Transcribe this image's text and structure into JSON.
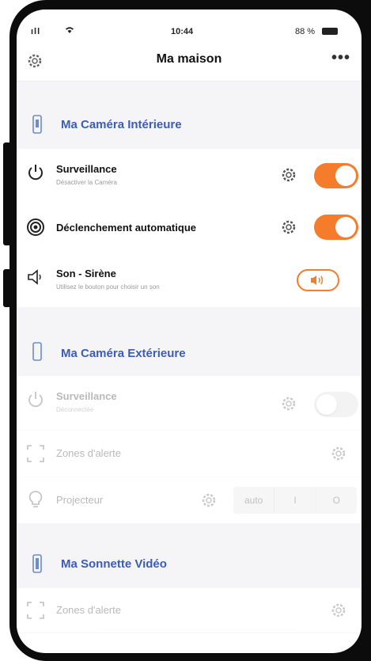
{
  "status": {
    "signal": "ıll",
    "time": "10:44",
    "battery": "88 %"
  },
  "header": {
    "title": "Ma maison",
    "more": "•••",
    "settings_icon": "gear-icon"
  },
  "sections": {
    "interior": {
      "label": "Ma Caméra Intérieure"
    },
    "exterior": {
      "label": "Ma Caméra Extérieure"
    },
    "doorbell": {
      "label": "Ma Sonnette Vidéo"
    }
  },
  "interior": {
    "surveillance": {
      "title": "Surveillance",
      "subtitle": "Désactiver la Caméra",
      "on": true
    },
    "auto": {
      "title": "Déclenchement automatique",
      "on": true
    },
    "siren": {
      "title": "Son - Sirène",
      "subtitle": "Utilisez le bouton pour choisir un son"
    }
  },
  "exterior": {
    "surveillance": {
      "title": "Surveillance",
      "subtitle": "Déconnectée",
      "on": false
    },
    "zones": {
      "title": "Zones d'alerte"
    },
    "projector": {
      "title": "Projecteur",
      "options": [
        "auto",
        "I",
        "O"
      ]
    }
  },
  "doorbell": {
    "zones": {
      "title": "Zones d'alerte"
    }
  },
  "colors": {
    "accent": "#f47c2a",
    "section_text": "#3d5cb3"
  }
}
